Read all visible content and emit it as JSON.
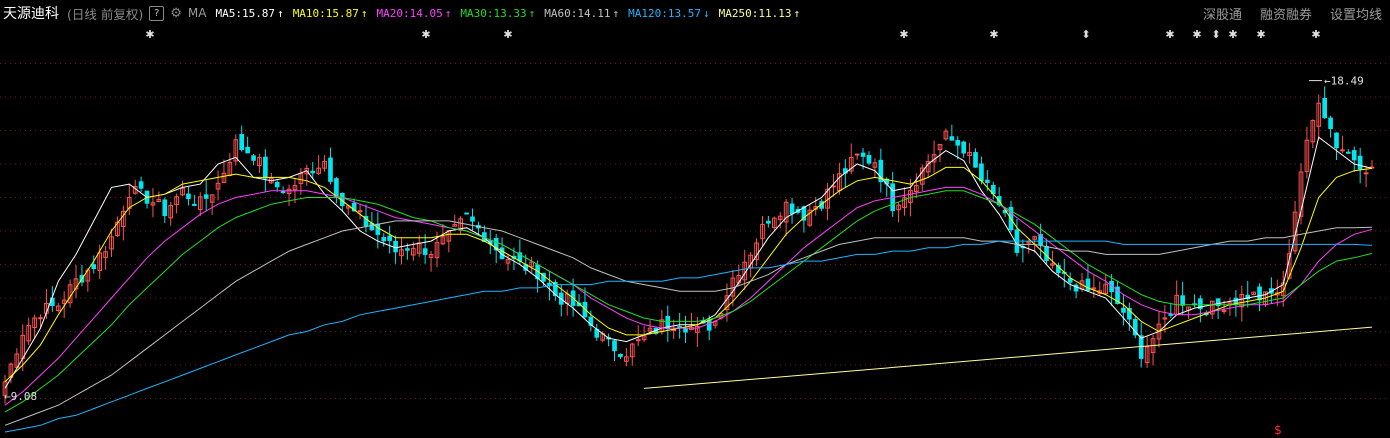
{
  "header": {
    "stock_name": "天源迪科",
    "period": "(日线 前复权)",
    "help": "?",
    "ma_label": "MA",
    "buttons": [
      "深股通",
      "融资融券",
      "设置均线"
    ]
  },
  "chart_data": {
    "type": "candlestick",
    "ylim": [
      8.0,
      20.0
    ],
    "colors": {
      "up": "#ff5252",
      "down": "#00e5ee"
    },
    "indicators": [
      {
        "name": "MA5",
        "value": "15.87",
        "dir": "↑",
        "color": "#ffffff"
      },
      {
        "name": "MA10",
        "value": "15.87",
        "dir": "↑",
        "color": "#ffff00"
      },
      {
        "name": "MA20",
        "value": "14.05",
        "dir": "↑",
        "color": "#ff40ff"
      },
      {
        "name": "MA30",
        "value": "13.33",
        "dir": "↑",
        "color": "#22dd22"
      },
      {
        "name": "MA60",
        "value": "14.11",
        "dir": "↑",
        "color": "#c0c0c0"
      },
      {
        "name": "MA120",
        "value": "13.57",
        "dir": "↓",
        "color": "#1eb4ff"
      },
      {
        "name": "MA250",
        "value": "11.13",
        "dir": "↑",
        "color": "#ffff99"
      }
    ],
    "annotations": {
      "high": "18.49",
      "low": "9.08",
      "marker": "$"
    },
    "anchors": [
      9.5,
      11.0,
      11.6,
      11.8,
      12.5,
      13.0,
      13.8,
      15.2,
      15.0,
      14.6,
      15.2,
      14.8,
      15.4,
      16.6,
      16.3,
      15.4,
      15.2,
      15.8,
      16.1,
      14.8,
      14.4,
      13.9,
      13.4,
      13.6,
      13.4,
      13.8,
      14.4,
      13.9,
      13.3,
      13.0,
      12.8,
      12.1,
      11.8,
      11.2,
      10.6,
      10.4,
      10.8,
      11.2,
      11.3,
      11.0,
      11.3,
      12.6,
      13.4,
      14.4,
      14.8,
      14.5,
      14.9,
      15.6,
      16.2,
      16.1,
      14.8,
      15.3,
      16.1,
      16.8,
      16.5,
      15.5,
      14.8,
      13.4,
      13.7,
      12.8,
      12.5,
      12.2,
      12.3,
      11.6,
      10.4,
      11.0,
      12.0,
      11.8,
      11.7,
      11.9,
      12.1,
      12.0,
      12.3,
      15.8,
      18.0,
      16.6,
      16.2,
      15.8
    ],
    "ma_series": [
      {
        "name": "MA5",
        "values": [
          9.3,
          10.2,
          11.1,
          12.5,
          13.3,
          14.3,
          15.3,
          15.4,
          15.0,
          15.1,
          15.3,
          15.4,
          16.0,
          16.2,
          15.6,
          15.5,
          15.6,
          15.8,
          15.1,
          14.6,
          14.0,
          13.7,
          13.5,
          13.6,
          13.7,
          14.0,
          14.1,
          13.8,
          13.3,
          13.0,
          12.6,
          12.1,
          11.7,
          11.2,
          10.8,
          10.7,
          10.9,
          11.1,
          11.2,
          11.2,
          11.5,
          12.2,
          13.0,
          13.8,
          14.4,
          14.7,
          15.0,
          15.6,
          16.0,
          15.8,
          15.2,
          15.3,
          16.0,
          16.4,
          16.1,
          15.2,
          14.5,
          13.6,
          13.4,
          12.8,
          12.4,
          12.2,
          12.0,
          11.4,
          10.8,
          11.0,
          11.5,
          11.7,
          11.8,
          11.9,
          12.0,
          12.1,
          12.4,
          14.6,
          16.8,
          16.4,
          16.0,
          15.87
        ]
      },
      {
        "name": "MA10",
        "values": [
          9.5,
          10.0,
          10.6,
          11.5,
          12.3,
          13.1,
          14.0,
          14.7,
          15.0,
          15.1,
          15.4,
          15.5,
          15.6,
          15.7,
          15.6,
          15.6,
          15.6,
          15.5,
          15.3,
          14.9,
          14.5,
          14.1,
          13.8,
          13.8,
          13.8,
          13.9,
          13.9,
          13.7,
          13.4,
          13.1,
          12.8,
          12.4,
          12.0,
          11.5,
          11.1,
          10.9,
          10.9,
          11.0,
          11.1,
          11.2,
          11.4,
          11.9,
          12.5,
          13.2,
          13.9,
          14.4,
          14.8,
          15.2,
          15.5,
          15.6,
          15.5,
          15.4,
          15.6,
          15.9,
          15.9,
          15.5,
          14.9,
          14.1,
          13.6,
          13.1,
          12.6,
          12.3,
          12.1,
          11.8,
          11.3,
          11.0,
          11.2,
          11.4,
          11.6,
          11.8,
          11.9,
          12.0,
          12.2,
          13.5,
          15.0,
          15.6,
          15.8,
          15.87
        ]
      },
      {
        "name": "MA20",
        "values": [
          8.8,
          9.2,
          9.7,
          10.2,
          10.8,
          11.4,
          12.0,
          12.6,
          13.2,
          13.7,
          14.1,
          14.5,
          14.8,
          15.0,
          15.1,
          15.2,
          15.2,
          15.2,
          15.1,
          15.0,
          14.8,
          14.6,
          14.4,
          14.3,
          14.2,
          14.1,
          14.0,
          13.8,
          13.6,
          13.3,
          13.0,
          12.7,
          12.4,
          12.0,
          11.7,
          11.4,
          11.2,
          11.1,
          11.1,
          11.1,
          11.3,
          11.6,
          12.0,
          12.5,
          13.0,
          13.5,
          13.9,
          14.3,
          14.7,
          14.9,
          15.0,
          15.1,
          15.2,
          15.3,
          15.3,
          15.1,
          14.8,
          14.4,
          14.0,
          13.6,
          13.2,
          12.8,
          12.5,
          12.1,
          11.8,
          11.6,
          11.5,
          11.5,
          11.6,
          11.7,
          11.8,
          11.8,
          11.9,
          12.4,
          13.1,
          13.6,
          13.9,
          14.05
        ]
      },
      {
        "name": "MA30",
        "values": [
          8.6,
          8.9,
          9.3,
          9.7,
          10.2,
          10.7,
          11.2,
          11.8,
          12.3,
          12.8,
          13.3,
          13.7,
          14.1,
          14.4,
          14.6,
          14.8,
          14.9,
          15.0,
          15.0,
          15.0,
          14.9,
          14.8,
          14.6,
          14.4,
          14.3,
          14.1,
          14.0,
          13.8,
          13.6,
          13.3,
          13.0,
          12.7,
          12.4,
          12.1,
          11.8,
          11.6,
          11.4,
          11.3,
          11.3,
          11.3,
          11.4,
          11.6,
          11.9,
          12.3,
          12.7,
          13.1,
          13.5,
          13.9,
          14.3,
          14.6,
          14.8,
          15.0,
          15.1,
          15.2,
          15.2,
          15.0,
          14.8,
          14.5,
          14.2,
          13.8,
          13.4,
          13.0,
          12.7,
          12.4,
          12.1,
          11.9,
          11.8,
          11.8,
          11.8,
          11.8,
          11.8,
          11.9,
          12.0,
          12.4,
          12.8,
          13.1,
          13.2,
          13.33
        ]
      },
      {
        "name": "MA60",
        "values": [
          8.2,
          8.4,
          8.6,
          8.8,
          9.1,
          9.4,
          9.7,
          10.1,
          10.5,
          10.9,
          11.3,
          11.7,
          12.1,
          12.5,
          12.8,
          13.1,
          13.4,
          13.6,
          13.8,
          14.0,
          14.1,
          14.2,
          14.3,
          14.3,
          14.3,
          14.3,
          14.2,
          14.1,
          14.0,
          13.8,
          13.6,
          13.4,
          13.2,
          12.9,
          12.7,
          12.5,
          12.4,
          12.3,
          12.2,
          12.2,
          12.2,
          12.3,
          12.5,
          12.7,
          13.0,
          13.2,
          13.4,
          13.6,
          13.7,
          13.8,
          13.8,
          13.8,
          13.8,
          13.8,
          13.8,
          13.7,
          13.7,
          13.6,
          13.6,
          13.5,
          13.4,
          13.4,
          13.3,
          13.3,
          13.3,
          13.3,
          13.4,
          13.5,
          13.6,
          13.7,
          13.7,
          13.8,
          13.8,
          13.9,
          14.0,
          14.1,
          14.1,
          14.11
        ]
      },
      {
        "name": "MA120",
        "values": [
          8.0,
          8.1,
          8.2,
          8.4,
          8.5,
          8.7,
          8.9,
          9.1,
          9.3,
          9.5,
          9.7,
          9.9,
          10.1,
          10.3,
          10.5,
          10.7,
          10.9,
          11.0,
          11.2,
          11.3,
          11.5,
          11.6,
          11.7,
          11.8,
          11.9,
          12.0,
          12.1,
          12.2,
          12.2,
          12.3,
          12.3,
          12.4,
          12.4,
          12.4,
          12.5,
          12.5,
          12.5,
          12.5,
          12.6,
          12.6,
          12.7,
          12.8,
          12.9,
          12.9,
          13.0,
          13.1,
          13.1,
          13.2,
          13.3,
          13.3,
          13.4,
          13.4,
          13.5,
          13.5,
          13.6,
          13.6,
          13.7,
          13.7,
          13.7,
          13.7,
          13.7,
          13.7,
          13.7,
          13.6,
          13.6,
          13.6,
          13.6,
          13.6,
          13.6,
          13.6,
          13.6,
          13.6,
          13.6,
          13.6,
          13.6,
          13.6,
          13.6,
          13.57
        ]
      },
      {
        "name": "MA250",
        "x": [
          36,
          77
        ],
        "values": [
          9.3,
          11.13
        ]
      }
    ]
  }
}
